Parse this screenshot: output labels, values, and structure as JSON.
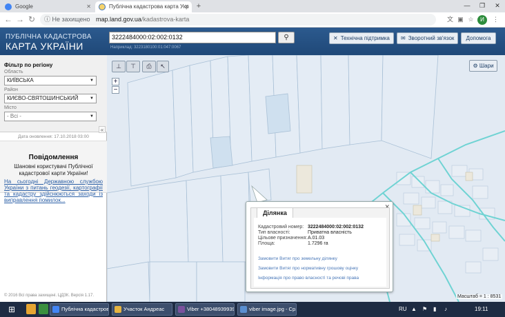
{
  "browser": {
    "tabs": [
      {
        "title": "Google",
        "active": false
      },
      {
        "title": "Публічна кадастрова карта Укр",
        "active": true
      }
    ],
    "address": {
      "security": "Не захищено",
      "host": "map.land.gov.ua",
      "path": "/kadastrova-karta"
    },
    "avatar_letter": "И"
  },
  "header": {
    "logo_line1": "ПУБЛІЧНА КАДАСТРОВА",
    "logo_line2": "КАРТА УКРАЇНИ",
    "search_value": "3222484000:02:002:0132",
    "search_hint": "Наприклад: 3223180100:01:047:0067",
    "buttons": {
      "support": "Технічна підтримка",
      "feedback": "Зворотний зв'язок",
      "help": "Допомога"
    }
  },
  "sidebar": {
    "filter_title": "Фільтр по регіону",
    "oblast_label": "Область",
    "oblast_value": "КИЇВСЬКА",
    "raion_label": "Район",
    "raion_value": "КИЄВО-СВЯТОШИНСЬКИЙ",
    "misto_label": "Місто",
    "misto_value": "- Всі -",
    "updated": "Дата оновлення: 17.10.2018 03:00",
    "notice_title": "Повідомлення",
    "notice_body": "Шановні користувачі Публічної кадастрової карти України!",
    "notice_link": "На сьогодні Державною службою України з питань геодезії, картографії та кадастру здійснюються заходи із виправлення помилок...",
    "copyright": "© 2016 Всі права захищені. ЦДЗК. Версія 1.17."
  },
  "map": {
    "layers_button": "Шари",
    "scale": "Масштаб = 1 : 8531",
    "popup": {
      "tab": "Ділянка",
      "fields": [
        {
          "label": "Кадастровий номер:",
          "value": "3222484000:02:002:0132"
        },
        {
          "label": "Тип власності:",
          "value": "Приватна власність"
        },
        {
          "label": "Цільове призначення:",
          "value": "A.01.03"
        },
        {
          "label": "Площа:",
          "value": "1.7296 га"
        }
      ],
      "links": [
        "Замовити Витяг про земельну ділянку",
        "Замовити Витяг про нормативну грошову оцінку",
        "Інформація про право власності та речові права"
      ]
    }
  },
  "taskbar": {
    "tasks": [
      "Публічна кадастров...",
      "Участок Андреас",
      "Viber +380489399393",
      "viber image.jpg - Ср..."
    ],
    "lang": "RU",
    "time": "19:11"
  },
  "colors": {
    "header_bg": "#1f4878",
    "map_bg": "#e2eaf3",
    "parcel_stroke": "#a9c0d6",
    "road": "#6fd3d3",
    "link": "#2b5fa6"
  }
}
